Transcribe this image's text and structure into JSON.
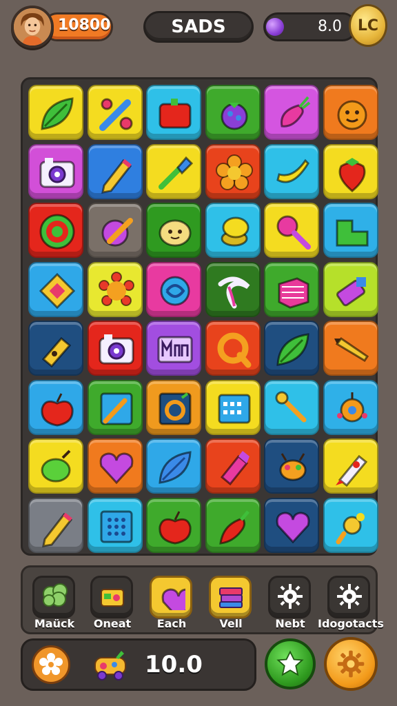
{
  "header": {
    "score": "10800",
    "title": "SADS",
    "meter_value": "8.0",
    "coin_label": "LC"
  },
  "board": {
    "rows": 8,
    "cols": 6,
    "tiles": [
      {
        "color": "#f4dc20",
        "icon": "leaf-icon"
      },
      {
        "color": "#f4dc20",
        "icon": "candy-tools-icon"
      },
      {
        "color": "#2fc0e8",
        "icon": "red-box-icon"
      },
      {
        "color": "#3faa2c",
        "icon": "berry-icon"
      },
      {
        "color": "#d455e0",
        "icon": "radish-icon"
      },
      {
        "color": "#f07a1e",
        "icon": "orange-face-icon"
      },
      {
        "color": "#d24fd8",
        "icon": "camera-icon"
      },
      {
        "color": "#2f7fe0",
        "icon": "pencil-icon"
      },
      {
        "color": "#f4dc20",
        "icon": "brush-icon"
      },
      {
        "color": "#e8431c",
        "icon": "flower-icon"
      },
      {
        "color": "#2fc0e8",
        "icon": "banana-icon"
      },
      {
        "color": "#f4dc20",
        "icon": "strawberry-icon"
      },
      {
        "color": "#e4261c",
        "icon": "target-ring-icon"
      },
      {
        "color": "#7a7068",
        "icon": "purple-candy-icon"
      },
      {
        "color": "#2f9a20",
        "icon": "potato-icon"
      },
      {
        "color": "#2fc0e8",
        "icon": "coins-icon"
      },
      {
        "color": "#f4dc20",
        "icon": "magnifier-icon"
      },
      {
        "color": "#2fb0e8",
        "icon": "green-box-icon"
      },
      {
        "color": "#2fa8e8",
        "icon": "diamond-gem-icon"
      },
      {
        "color": "#e8e830",
        "icon": "gear-flower-icon"
      },
      {
        "color": "#e83aa0",
        "icon": "swirl-icon"
      },
      {
        "color": "#2f7a20",
        "icon": "hook-icon"
      },
      {
        "color": "#3faa2c",
        "icon": "cube-icon"
      },
      {
        "color": "#b6e02a",
        "icon": "toy-block-icon"
      },
      {
        "color": "#1f4e80",
        "icon": "bottle-icon"
      },
      {
        "color": "#e4261c",
        "icon": "camera-icon"
      },
      {
        "color": "#a24ee0",
        "icon": "letters-icon"
      },
      {
        "color": "#e8431c",
        "icon": "q-ring-icon"
      },
      {
        "color": "#1f4e80",
        "icon": "green-leaf-icon"
      },
      {
        "color": "#f07a1e",
        "icon": "crayon-icon"
      },
      {
        "color": "#2fa8e8",
        "icon": "apple-icon"
      },
      {
        "color": "#3faa2c",
        "icon": "carrot-frame-icon"
      },
      {
        "color": "#f09a1e",
        "icon": "o-block-icon"
      },
      {
        "color": "#f4dc20",
        "icon": "calendar-icon"
      },
      {
        "color": "#2fc0e8",
        "icon": "wrench-icon"
      },
      {
        "color": "#2fb0e8",
        "icon": "robot-icon"
      },
      {
        "color": "#f4dc20",
        "icon": "lime-icon"
      },
      {
        "color": "#f07a1e",
        "icon": "heart-icon"
      },
      {
        "color": "#2fa8e8",
        "icon": "blue-leaf-icon"
      },
      {
        "color": "#e8431c",
        "icon": "pink-bottle-icon"
      },
      {
        "color": "#1f4e80",
        "icon": "bug-icon"
      },
      {
        "color": "#f4dc20",
        "icon": "rocket-icon"
      },
      {
        "color": "#7a7e86",
        "icon": "pencil-icon"
      },
      {
        "color": "#2fc0e8",
        "icon": "grid-icon"
      },
      {
        "color": "#3faa2c",
        "icon": "apple-icon"
      },
      {
        "color": "#3faa2c",
        "icon": "chili-icon"
      },
      {
        "color": "#1f4e80",
        "icon": "heart-icon"
      },
      {
        "color": "#2fc0e8",
        "icon": "pacifier-icon"
      }
    ]
  },
  "tray": {
    "items": [
      {
        "label": "Maück",
        "icon": "broccoli-icon",
        "color": "#8fd06a"
      },
      {
        "label": "Oneat",
        "icon": "radio-icon",
        "color": "#f4c830"
      },
      {
        "label": "Each",
        "icon": "heart-icon",
        "color": "#9fe6f0",
        "highlight": "#f4c830"
      },
      {
        "label": "Vell",
        "icon": "books-icon",
        "color": "#b04ad0",
        "highlight": "#f4c830"
      },
      {
        "label": "Nebt",
        "icon": "gear-icon",
        "color": "#ffffff"
      },
      {
        "label": "Idogotacts",
        "icon": "gear-icon",
        "color": "#d8d0c8"
      }
    ]
  },
  "bottom": {
    "value": "10.0"
  }
}
